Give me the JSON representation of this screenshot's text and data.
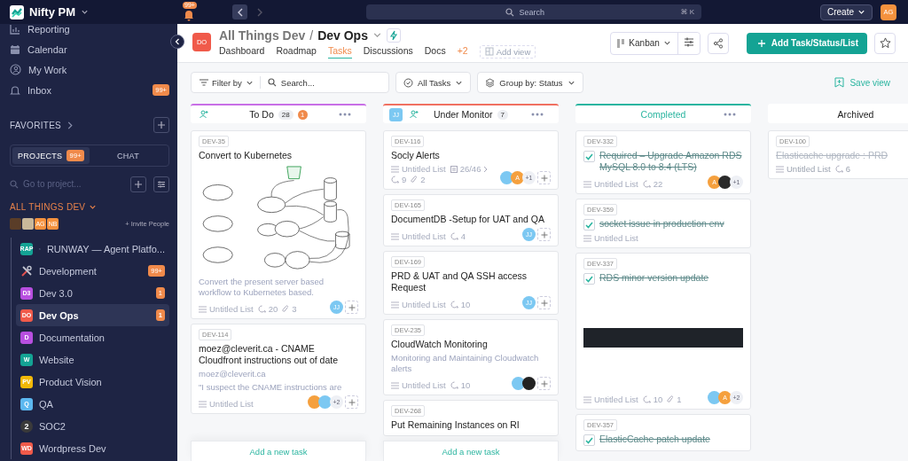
{
  "topbar": {
    "workspace": "Nifty PM",
    "notifications": "99+",
    "search": {
      "placeholder": "Search",
      "shortcut": "⌘ K"
    },
    "create": "Create",
    "user": "AG"
  },
  "sidebar": {
    "nav": [
      {
        "label": "Reporting",
        "kind": "reporting"
      },
      {
        "label": "Calendar",
        "kind": "calendar"
      },
      {
        "label": "My Work",
        "kind": "mywork"
      },
      {
        "label": "Inbox",
        "kind": "inbox",
        "badge": "99+"
      }
    ],
    "favorites": "FAVORITES",
    "tabs": [
      {
        "label": "PROJECTS",
        "badge": "99+",
        "selected": true
      },
      {
        "label": "CHAT",
        "selected": false
      }
    ],
    "project_search": {
      "placeholder": "Go to project..."
    },
    "group": {
      "title": "ALL THINGS DEV",
      "members": [
        {
          "color": "#5a3d28"
        },
        {
          "color": "#c9b89a"
        },
        {
          "initials": "AG",
          "color": "#f5923e"
        },
        {
          "initials": "NB",
          "color": "#f5923e"
        }
      ],
      "invite": "+ Invite People"
    },
    "projects": [
      {
        "kind": "runway",
        "badge": "RAP",
        "color": "#14a394",
        "name": "RUNWAY — Agent Platfo...",
        "selected": false
      },
      {
        "kind": "tools",
        "name": "Development",
        "count": "99+",
        "selected": false
      },
      {
        "kind": "badge",
        "badge": "D3",
        "color": "#b84fe0",
        "name": "Dev 3.0",
        "count": "1",
        "selected": false
      },
      {
        "kind": "badge",
        "badge": "DO",
        "color": "#f05a4a",
        "name": "Dev Ops",
        "count": "1",
        "selected": true
      },
      {
        "kind": "badge",
        "badge": "D",
        "color": "#b84fe0",
        "name": "Documentation",
        "selected": false
      },
      {
        "kind": "badge",
        "badge": "W",
        "color": "#14a394",
        "name": "Website",
        "selected": false
      },
      {
        "kind": "badge",
        "badge": "PV",
        "color": "#f2b807",
        "name": "Product Vision",
        "selected": false
      },
      {
        "kind": "badge",
        "badge": "Q",
        "color": "#5cb8f0",
        "name": "QA",
        "selected": false
      },
      {
        "kind": "number",
        "badge": "2",
        "color": "#3a3a3a",
        "name": "SOC2",
        "selected": false
      },
      {
        "kind": "badge",
        "badge": "WD",
        "color": "#f05a4a",
        "name": "Wordpress Dev",
        "selected": false
      }
    ]
  },
  "header": {
    "badge": "DO",
    "color": "#f05a4a",
    "workspace": "All Things Dev",
    "separator": "/",
    "project": "Dev Ops",
    "tabs": [
      {
        "label": "Dashboard",
        "selected": false
      },
      {
        "label": "Roadmap",
        "selected": false
      },
      {
        "label": "Tasks",
        "selected": true
      },
      {
        "label": "Discussions",
        "selected": false
      },
      {
        "label": "Docs",
        "selected": false
      }
    ],
    "more": "+2",
    "add_view": "Add view",
    "view": "Kanban",
    "primary": "Add Task/Status/List"
  },
  "toolbar": {
    "filter": "Filter by",
    "search": {
      "placeholder": "Search..."
    },
    "tasks": "All Tasks",
    "group_label": "Group by:",
    "group_value": "Status",
    "save": "Save view"
  },
  "columns": [
    {
      "kind": "active",
      "title": "To Do",
      "color": "#c86ee6",
      "count": "28",
      "alert": "1",
      "add_task": "Add a new task",
      "cards": [
        {
          "kind": "diagram",
          "id": "DEV-35",
          "title": "Convert to Kubernetes",
          "done": false,
          "description": [
            "Convert the present server based workflow to Kubernetes based."
          ],
          "list": "Untitled List",
          "comments": "20",
          "attachments": "3",
          "assignees": [
            {
              "initials": "JJ",
              "color": "#7cc8f2"
            }
          ]
        },
        {
          "kind": "text",
          "id": "DEV-114",
          "title": " moez@cleverit.ca -  CNAME Cloudfront instructions out of date",
          "done": false,
          "description": [
            "moez@cleverit.ca",
            "\"I suspect the CNAME instructions are"
          ],
          "list": "Untitled List",
          "assignees": [
            {
              "color": "#f5a03e"
            },
            {
              "color": "#7cc8f2"
            }
          ],
          "extra": "+2"
        }
      ]
    },
    {
      "kind": "active",
      "title": "Under Monitor",
      "color": "#f07060",
      "count": "7",
      "member": "JJ",
      "add_task": "Add a new task",
      "cards": [
        {
          "kind": "text",
          "id": "DEV-116",
          "title": "Socly Alerts",
          "done": false,
          "list": "Untitled List",
          "subtasks": "26/46",
          "comments": "9",
          "attachments": "2",
          "assignees": [
            {
              "color": "#7cc8f2"
            },
            {
              "initials": "A",
              "color": "#f5a03e"
            }
          ],
          "extra": "+1"
        },
        {
          "kind": "text",
          "id": "DEV-165",
          "title": "DocumentDB -Setup for UAT and QA",
          "done": false,
          "list": "Untitled List",
          "comments": "4",
          "assignees": [
            {
              "initials": "JJ",
              "color": "#7cc8f2"
            }
          ]
        },
        {
          "kind": "text",
          "id": "DEV-169",
          "title": "PRD & UAT and QA SSH  access Request",
          "done": false,
          "list": "Untitled List",
          "comments": "10",
          "assignees": [
            {
              "initials": "JJ",
              "color": "#7cc8f2"
            }
          ]
        },
        {
          "kind": "text",
          "id": "DEV-235",
          "title": "CloudWatch Monitoring",
          "done": false,
          "description": [
            "Monitoring and Maintaining Cloudwatch alerts"
          ],
          "list": "Untitled List",
          "comments": "10",
          "assignees": [
            {
              "color": "#7cc8f2"
            },
            {
              "color": "#222222"
            }
          ]
        },
        {
          "kind": "text",
          "id": "DEV-268",
          "title": "Put Remaining Instances on RI",
          "done": false
        }
      ]
    },
    {
      "kind": "completed",
      "title": "Completed",
      "color": "#2bb5a0",
      "cards": [
        {
          "kind": "text",
          "id": "DEV-332",
          "title": "Required – Upgrade Amazon RDS MySQL 8.0 to 8.4 (LTS)",
          "done": true,
          "list": "Untitled List",
          "comments": "22",
          "assignees": [
            {
              "initials": "A",
              "color": "#f5a03e"
            },
            {
              "color": "#2a2a2a"
            }
          ],
          "extra": "+1"
        },
        {
          "kind": "text",
          "id": "DEV-359",
          "title": "socket issue in production env",
          "done": true,
          "list": "Untitled List"
        },
        {
          "kind": "screenshot",
          "id": "DEV-337",
          "title": "RDS minor version update",
          "done": true,
          "list": "Untitled List",
          "comments": "10",
          "attachments": "1",
          "assignees": [
            {
              "color": "#7cc8f2"
            },
            {
              "initials": "A",
              "color": "#f5a03e"
            }
          ],
          "extra": "+2"
        },
        {
          "kind": "text",
          "id": "DEV-357",
          "title": "ElasticCache patch update",
          "done": true
        }
      ]
    },
    {
      "kind": "archived",
      "title": "Archived",
      "cards": [
        {
          "kind": "text",
          "id": "DEV-100",
          "title": "Elasticache upgrade : PRD",
          "done": true,
          "list": "Untitled List",
          "comments": "6"
        }
      ]
    }
  ]
}
